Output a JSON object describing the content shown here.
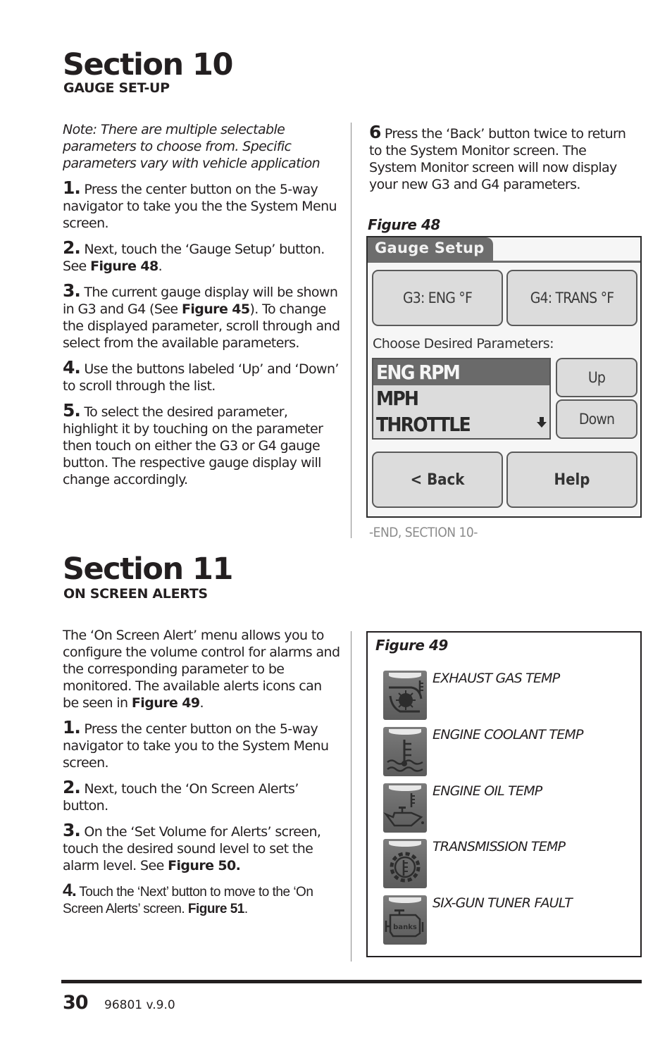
{
  "section10": {
    "title": "Section 10",
    "subtitle": "GAUGE SET-UP",
    "note": "Note: There are multiple selectable parameters to choose from. Specific parameters vary with vehicle application",
    "steps": [
      {
        "num": "1.",
        "text": "Press the center button on the 5-way navigator to take you the the System Menu screen."
      },
      {
        "num": "2.",
        "text_before": "Next, touch the ‘Gauge Setup’ button. See ",
        "ref": "Figure 48",
        "text_after": "."
      },
      {
        "num": "3.",
        "text_before": "The current gauge display will be shown in G3 and G4 (See ",
        "ref": "Figure 45",
        "text_after": "). To change the displayed parameter, scroll through and select from the available parameters."
      },
      {
        "num": "4.",
        "text": "Use the buttons labeled ‘Up’ and ‘Down’ to scroll through the list."
      },
      {
        "num": "5.",
        "text": "To select the desired parameter, highlight it by touching on the parameter then touch on either the G3 or G4 gauge button. The respective gauge display will change accordingly."
      },
      {
        "num": "6",
        "text": "Press the ‘Back’ button twice to return to the System Monitor screen. The System Monitor screen will now display your new G3 and G4 parameters."
      }
    ],
    "figure48": {
      "label": "Figure 48",
      "screen_title": "Gauge Setup",
      "g3_button": "G3: ENG °F",
      "g4_button": "G4: TRANS °F",
      "choose_label": "Choose Desired Parameters:",
      "parameters": [
        "ENG RPM",
        "MPH",
        "THROTTLE"
      ],
      "selected_parameter": "ENG RPM",
      "scroll_icon": "down-arrow-icon",
      "up_button": "Up",
      "down_button": "Down",
      "back_button": "< Back",
      "help_button": "Help"
    },
    "end_note": "-END, SECTION 10-"
  },
  "section11": {
    "title": "Section 11",
    "subtitle": "ON SCREEN ALERTS",
    "intro_before": "The ‘On Screen Alert’ menu allows you to configure the volume control for alarms and the corresponding parameter to be monitored. The available alerts icons can be seen in ",
    "intro_ref": "Figure 49",
    "intro_after": ".",
    "steps": [
      {
        "num": "1.",
        "text": "Press the center button on the 5-way navigator to take you to the System Menu screen."
      },
      {
        "num": "2.",
        "text": "Next, touch the ‘On Screen Alerts’ button."
      },
      {
        "num": "3.",
        "text_before": "On the ‘Set Volume for Alerts’ screen, touch the desired sound level to set the alarm level. See ",
        "ref": "Figure 50.",
        "text_after": ""
      },
      {
        "num": "4.",
        "text_before": "Touch the ‘Next’ button to move to the ‘On Screen Alerts’ screen. ",
        "ref": "Figure 51",
        "text_after": "."
      }
    ],
    "figure49": {
      "label": "Figure 49",
      "alerts": [
        {
          "icon": "exhaust-gas-temp-icon",
          "label": "EXHAUST GAS TEMP"
        },
        {
          "icon": "engine-coolant-temp-icon",
          "label": "ENGINE COOLANT TEMP"
        },
        {
          "icon": "engine-oil-temp-icon",
          "label": "ENGINE OIL TEMP"
        },
        {
          "icon": "transmission-temp-icon",
          "label": "TRANSMISSION TEMP"
        },
        {
          "icon": "six-gun-tuner-fault-icon",
          "label": "SIX-GUN TUNER FAULT"
        }
      ],
      "fault_icon_text": "banks"
    }
  },
  "footer": {
    "page_number": "30",
    "doc_version": "96801 v.9.0"
  }
}
